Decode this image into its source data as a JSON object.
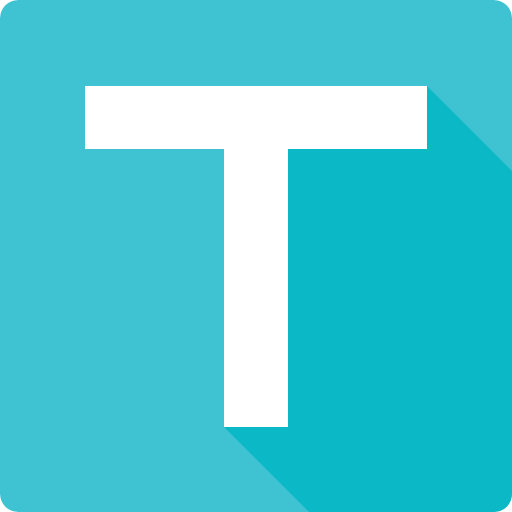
{
  "app_icon": {
    "glyph": "T",
    "icon_name": "letter-t-icon",
    "colors": {
      "background": "#3fc3d2",
      "long_shadow": "#0bb9c6",
      "letter": "#ffffff"
    }
  }
}
